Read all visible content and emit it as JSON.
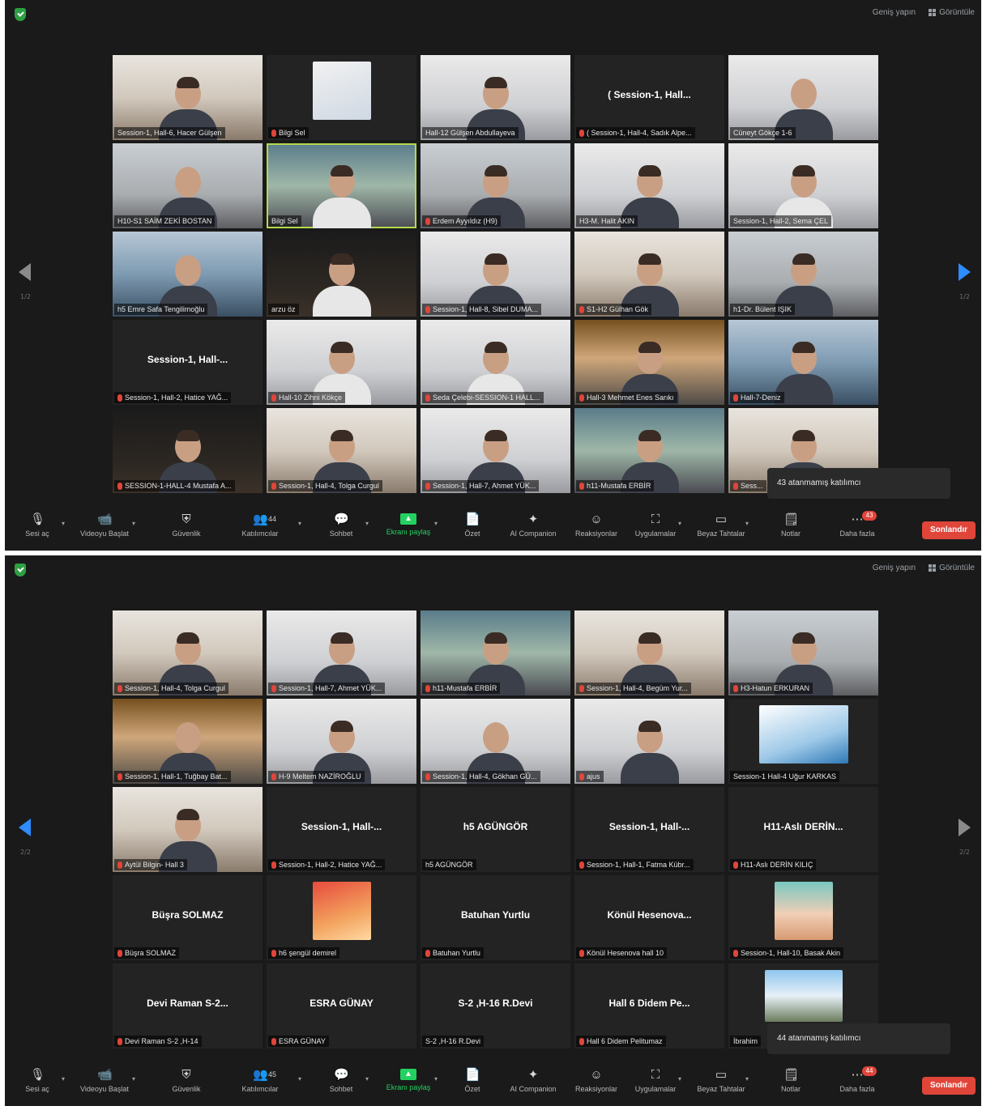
{
  "topbar": {
    "fullscreen_label": "Geniş yapın",
    "view_label": "Görüntüle"
  },
  "colors": {
    "accent": "#2d8cff",
    "share": "#23d160",
    "end": "#e0453a",
    "active_speaker": "#b6d94c"
  },
  "toolbar": {
    "audio_label": "Sesi aç",
    "video_label": "Videoyu Başlat",
    "security_label": "Güvenlik",
    "participants_label": "Katılımcılar",
    "chat_label": "Sohbet",
    "share_label": "Ekranı paylaş",
    "summary_label": "Özet",
    "ai_label": "AI Companion",
    "reactions_label": "Reaksiyonlar",
    "apps_label": "Uygulamalar",
    "whiteboard_label": "Beyaz Tahtalar",
    "notes_label": "Notlar",
    "more_label": "Daha fazla",
    "end_label": "Sonlandır"
  },
  "screens": [
    {
      "page_indicator": "1/2",
      "participants_count": "44",
      "more_badge": "43",
      "tooltip": "43 atanmamış katılımcı",
      "tiles": [
        {
          "kind": "video",
          "v": "v3",
          "name": "Session-1, Hall-6, Hacer Gülşen",
          "muted": false
        },
        {
          "kind": "photo",
          "photo": "logo",
          "name": "Bilgi Sel",
          "muted": true
        },
        {
          "kind": "video",
          "v": "v6",
          "name": "Hall-12 Gülşen Abdullayeva",
          "muted": false
        },
        {
          "kind": "avatar",
          "avatar": "( Session-1, Hall...",
          "name": "( Session-1, Hall-4, Sadık Alpe...",
          "muted": true
        },
        {
          "kind": "video",
          "v": "v6",
          "name": "Cüneyt Gökçe 1-6",
          "muted": false,
          "bald": true
        },
        {
          "kind": "video",
          "v": "v2",
          "name": "H10-S1 SAİM ZEKİ BOSTAN",
          "muted": false,
          "bald": true
        },
        {
          "kind": "video",
          "v": "v4",
          "name": "Bilgi Sel",
          "muted": false,
          "active": true,
          "light": true
        },
        {
          "kind": "video",
          "v": "v2",
          "name": "Erdem Ayyıldız (H9)",
          "muted": true
        },
        {
          "kind": "video",
          "v": "v6",
          "name": "H3-M. Halit AKIN",
          "muted": false
        },
        {
          "kind": "video",
          "v": "v6",
          "name": "Session-1, Hall-2, Sema ÇEL",
          "muted": false,
          "light": true
        },
        {
          "kind": "video",
          "v": "v8",
          "name": "h5 Emre Safa Tengilimoğlu",
          "muted": false,
          "bald": true
        },
        {
          "kind": "video",
          "v": "v5",
          "name": "arzu öz",
          "muted": false,
          "light": true
        },
        {
          "kind": "video",
          "v": "v6",
          "name": "Session-1, Hall-8, Sibel DUMA...",
          "muted": true
        },
        {
          "kind": "video",
          "v": "v3",
          "name": "S1-H2 Gülhan Gök",
          "muted": true
        },
        {
          "kind": "video",
          "v": "v2",
          "name": "h1-Dr. Bülent IŞIK",
          "muted": false
        },
        {
          "kind": "avatar",
          "avatar": "Session-1, Hall-...",
          "name": "Session-1, Hall-2, Hatice YAĞ...",
          "muted": true
        },
        {
          "kind": "video",
          "v": "v6",
          "name": "Hall-10 Zihni Kökçe",
          "muted": true,
          "light": true
        },
        {
          "kind": "video",
          "v": "v6",
          "name": "Seda Çelebi-SESSION-1 HALL...",
          "muted": true,
          "light": true
        },
        {
          "kind": "video",
          "v": "v7",
          "name": "Hall-3 Mehmet Enes Sarıkı",
          "muted": true
        },
        {
          "kind": "video",
          "v": "v8",
          "name": "Hall-7-Deniz",
          "muted": true
        },
        {
          "kind": "video",
          "v": "v5",
          "name": "SESSION-1-HALL-4 Mustafa A...",
          "muted": true
        },
        {
          "kind": "video",
          "v": "v3",
          "name": "Session-1, Hall-4, Tolga Curgul",
          "muted": true
        },
        {
          "kind": "video",
          "v": "v6",
          "name": "Session-1, Hall-7, Ahmet YÜK...",
          "muted": true
        },
        {
          "kind": "video",
          "v": "v4",
          "name": "h11-Mustafa ERBİR",
          "muted": true
        },
        {
          "kind": "video",
          "v": "v3",
          "name": "Sess...",
          "muted": true
        }
      ]
    },
    {
      "page_indicator": "2/2",
      "participants_count": "45",
      "more_badge": "44",
      "tooltip": "44 atanmamış katılımcı",
      "tiles": [
        {
          "kind": "video",
          "v": "v3",
          "name": "Session-1, Hall-4, Tolga Curgul",
          "muted": true
        },
        {
          "kind": "video",
          "v": "v6",
          "name": "Session-1, Hall-7, Ahmet YÜK...",
          "muted": true
        },
        {
          "kind": "video",
          "v": "v4",
          "name": "h11-Mustafa ERBİR",
          "muted": true
        },
        {
          "kind": "video",
          "v": "v3",
          "name": "Session-1, Hall-4, Begüm Yur...",
          "muted": true
        },
        {
          "kind": "video",
          "v": "v2",
          "name": "H3-Hatun ERKURAN",
          "muted": true
        },
        {
          "kind": "video",
          "v": "v7",
          "name": "Session-1, Hall-1, Tuğbay Bat...",
          "muted": true,
          "bald": true
        },
        {
          "kind": "video",
          "v": "v6",
          "name": "H-9 Meltem NAZİROĞLU",
          "muted": true
        },
        {
          "kind": "video",
          "v": "v6",
          "name": "Session-1, Hall-4, Gökhan GÜ...",
          "muted": true,
          "bald": true
        },
        {
          "kind": "video",
          "v": "v6",
          "name": "ajus",
          "muted": true
        },
        {
          "kind": "photo",
          "photo": "blue",
          "name": "Session-1 Hall-4 Uğur KARKAS",
          "muted": false
        },
        {
          "kind": "video",
          "v": "v3",
          "name": "Aytül Bilgin- Hall 3",
          "muted": true
        },
        {
          "kind": "avatar",
          "avatar": "Session-1, Hall-...",
          "name": "Session-1, Hall-2, Hatice YAĞ...",
          "muted": true
        },
        {
          "kind": "avatar",
          "avatar": "h5 AGÜNGÖR",
          "name": "h5 AGÜNGÖR",
          "muted": false
        },
        {
          "kind": "avatar",
          "avatar": "Session-1, Hall-...",
          "name": "Session-1, Hall-1, Fatma Kübr...",
          "muted": true
        },
        {
          "kind": "avatar",
          "avatar": "H11-Aslı DERİN...",
          "name": "H11-Aslı DERİN KILIÇ",
          "muted": true
        },
        {
          "kind": "avatar",
          "avatar": "Büşra SOLMAZ",
          "name": "Büşra SOLMAZ",
          "muted": true
        },
        {
          "kind": "photo",
          "photo": "warm",
          "name": "h6 şengül demirel",
          "muted": true
        },
        {
          "kind": "avatar",
          "avatar": "Batuhan Yurtlu",
          "name": "Batuhan Yurtlu",
          "muted": true
        },
        {
          "kind": "avatar",
          "avatar": "Könül Hesenova...",
          "name": "Könül Hesenova hall 10",
          "muted": true
        },
        {
          "kind": "photo",
          "photo": "portrait",
          "name": "Session-1, Hall-10, Basak Akin",
          "muted": true
        },
        {
          "kind": "avatar",
          "avatar": "Devi Raman S-2...",
          "name": "Devi Raman S-2 ,H-14",
          "muted": true
        },
        {
          "kind": "avatar",
          "avatar": "ESRA GÜNAY",
          "name": "ESRA GÜNAY",
          "muted": true
        },
        {
          "kind": "avatar",
          "avatar": "S-2 ,H-16 R.Devi",
          "name": "S-2 ,H-16 R.Devi",
          "muted": false
        },
        {
          "kind": "avatar",
          "avatar": "Hall 6 Didem Pe...",
          "name": "Hall 6 Didem Pelitumaz",
          "muted": true
        },
        {
          "kind": "photo",
          "photo": "mountain",
          "name": "İbrahim",
          "muted": false
        }
      ]
    }
  ]
}
